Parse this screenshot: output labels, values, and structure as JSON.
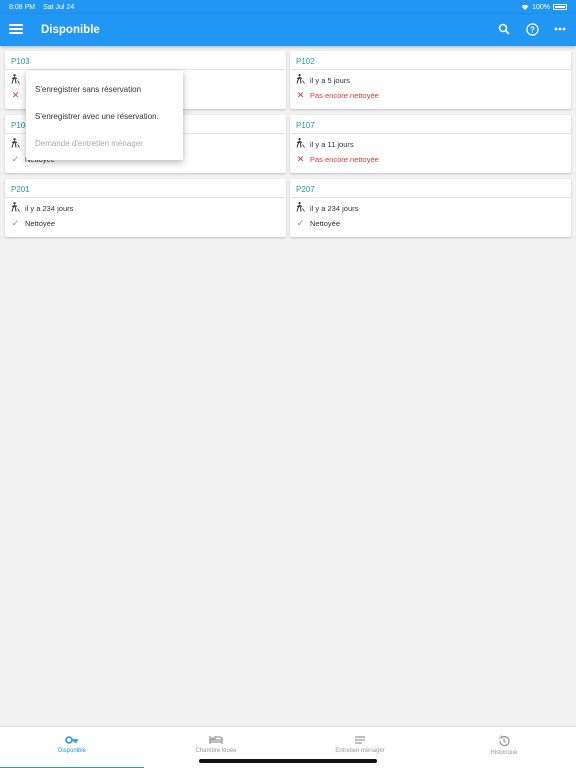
{
  "status_bar": {
    "time": "8:08 PM",
    "date": "Sat Jul 24",
    "battery": "100%"
  },
  "app_bar": {
    "title": "Disponible",
    "icons": [
      "menu-icon",
      "search-icon",
      "help-icon",
      "more-icon"
    ]
  },
  "rooms": [
    {
      "name": "P103",
      "since": "",
      "status": "",
      "clean": false
    },
    {
      "name": "P102",
      "since": "il y a 5 jours",
      "status": "Pas encore nettoyée",
      "clean": false
    },
    {
      "name": "P105",
      "since": "",
      "status": "Nettoyée",
      "clean": true
    },
    {
      "name": "P107",
      "since": "il y a 11 jours",
      "status": "Pas encore nettoyée",
      "clean": false
    },
    {
      "name": "P201",
      "since": "il y a 234 jours",
      "status": "Nettoyée",
      "clean": true
    },
    {
      "name": "P207",
      "since": "il y a 234 jours",
      "status": "Nettoyée",
      "clean": true
    }
  ],
  "popup_menu": {
    "items": [
      {
        "label": "S'enregistrer sans réservation",
        "enabled": true
      },
      {
        "label": "S'enregistrer avec une réservation.",
        "enabled": true
      },
      {
        "label": "Demande d'entretien ménager",
        "enabled": false
      }
    ]
  },
  "bottom_nav": {
    "items": [
      {
        "label": "Disponible",
        "icon": "key-icon",
        "active": true
      },
      {
        "label": "Chambre louée",
        "icon": "bed-icon",
        "active": false
      },
      {
        "label": "Entretien ménager",
        "icon": "list-icon",
        "active": false
      },
      {
        "label": "Historique",
        "icon": "history-icon",
        "active": false
      }
    ]
  },
  "colors": {
    "primary": "#2196f3",
    "room_label": "#1e9e9a",
    "dirty": "#e53935",
    "clean_check": "#4caf50"
  }
}
